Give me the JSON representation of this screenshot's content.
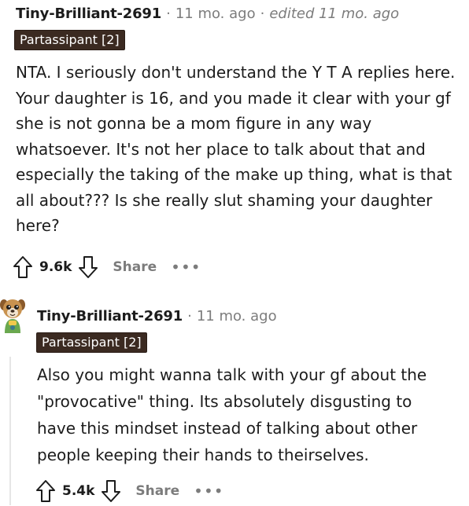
{
  "comment1": {
    "author": "Tiny-Brilliant-2691",
    "sep1": "·",
    "time": "11 mo. ago",
    "sep2": "·",
    "edited": "edited 11 mo. ago",
    "flair": "Partassipant [2]",
    "body_lines": [
      "NTA. I seriously don't understand the Y T A replies here.",
      "Your daughter is 16, and you made it clear with your gf",
      "she is not gonna be a mom figure in any way",
      "whatsoever. It's not her place to talk about that and",
      "especially the taking of the make up thing, what is that",
      "all about??? Is she really slut shaming your daughter",
      "here?"
    ],
    "score": "9.6k",
    "share_label": "Share",
    "more_label": "•••"
  },
  "comment2": {
    "author": "Tiny-Brilliant-2691",
    "sep1": "·",
    "time": "11 mo. ago",
    "flair": "Partassipant [2]",
    "body_lines": [
      "Also you might wanna talk with your gf about the",
      "\"provocative\" thing. Its absolutely disgusting to",
      "have this mindset instead of talking about other",
      "people keeping their hands to theirselves."
    ],
    "score": "5.4k",
    "share_label": "Share",
    "more_label": "•••"
  },
  "icons": {
    "upvote": "upvote-arrow-icon",
    "downvote": "downvote-arrow-icon",
    "more": "more-options-icon",
    "avatar": "user-avatar-dog"
  },
  "colors": {
    "flair_bg": "#3b2a21",
    "muted": "#7c7c7c",
    "text": "#1c1c1c"
  }
}
